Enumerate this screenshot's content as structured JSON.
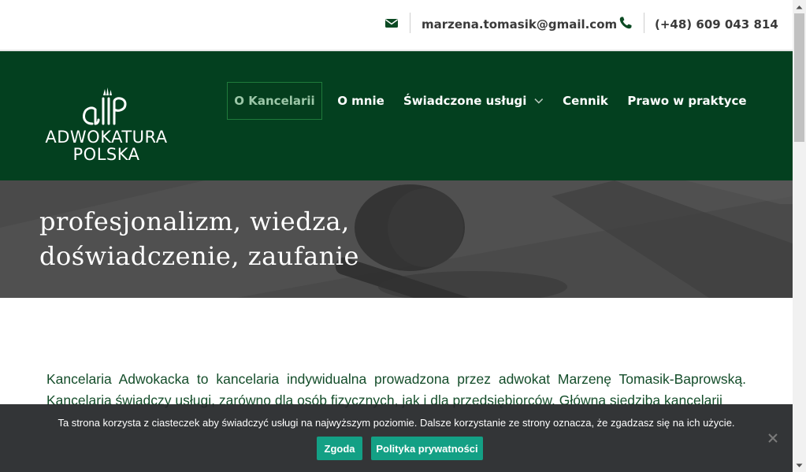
{
  "topbar": {
    "email": "marzena.tomasik@gmail.com",
    "phone": "(+48) 609 043 814",
    "email_icon": "envelope-icon",
    "phone_icon": "phone-icon"
  },
  "logo": {
    "line1": "ADWOKATURA",
    "line2": "POLSKA"
  },
  "nav": {
    "items": [
      {
        "label": "O Kancelarii",
        "active": true
      },
      {
        "label": "O mnie"
      },
      {
        "label": "Świadczone usługi",
        "has_dropdown": true
      },
      {
        "label": "Cennik"
      },
      {
        "label": "Prawo w praktyce"
      }
    ]
  },
  "hero": {
    "line1": "profesjonalizm, wiedza,",
    "line2": "doświadczenie, zaufanie"
  },
  "content": {
    "paragraph": "Kancelaria Adwokacka to kancelaria indywidualna prowadzona przez adwokat Marzenę Tomasik-Baprowską. Kancelaria świadczy usługi, zarówno dla osób fizycznych, jak i dla przedsiębiorców. Główna siedziba kancelarii"
  },
  "cookie": {
    "message": "Ta strona korzysta z ciasteczek aby świadczyć usługi na najwyższym poziomie. Dalsze korzystanie ze strony oznacza, że zgadzasz się na ich użycie.",
    "accept_label": "Zgoda",
    "policy_label": "Polityka prywatności"
  },
  "colors": {
    "brand_green": "#03401f",
    "text_green": "#144d2a",
    "button_teal": "#13a085"
  }
}
